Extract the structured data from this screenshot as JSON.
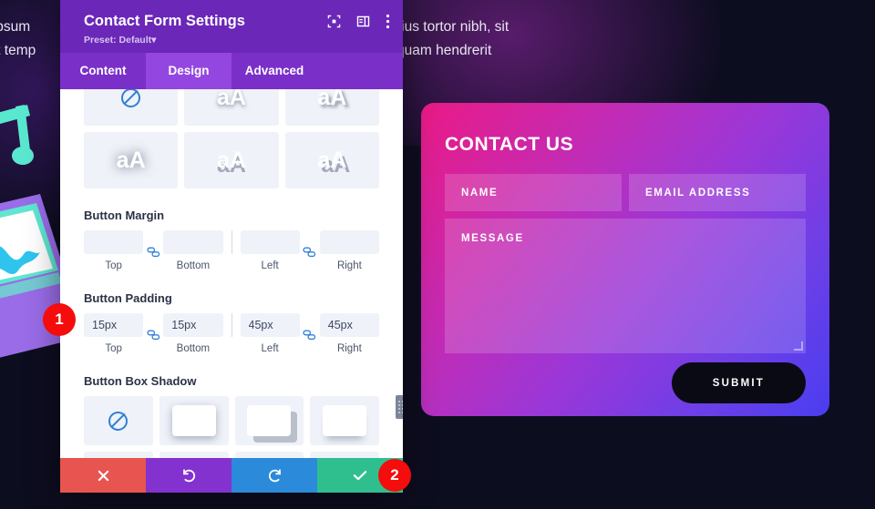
{
  "page": {
    "background_color": "#0d0d20",
    "copy_left": "em ipsum\namet temp",
    "copy_left_line1": "em ipsum",
    "copy_left_line2": "amet temp",
    "copy_right_line1": "rius tortor nibh, sit",
    "copy_right_line2": "quam hendrerit"
  },
  "contact_form": {
    "title": "CONTACT US",
    "gradient_start": "#ea1a86",
    "gradient_end": "#4a3def",
    "fields": [
      {
        "name": "name",
        "placeholder": "NAME"
      },
      {
        "name": "email",
        "placeholder": "EMAIL ADDRESS"
      }
    ],
    "message_placeholder": "MESSAGE",
    "submit_label": "SUBMIT",
    "submit_bg": "#0a0a14"
  },
  "modal": {
    "title": "Contact Form Settings",
    "preset_label": "Preset: Default",
    "preset_caret": "▾",
    "header_bg": "#6b27b8",
    "header_icons": [
      {
        "name": "focus-target-icon"
      },
      {
        "name": "layout-panel-icon"
      },
      {
        "name": "more-vertical-icon"
      }
    ],
    "tabs": [
      {
        "label": "Content",
        "active": false
      },
      {
        "label": "Design",
        "active": true
      },
      {
        "label": "Advanced",
        "active": false
      }
    ],
    "text_shadow": {
      "presets": [
        {
          "name": "none",
          "glyph": "",
          "style": "none"
        },
        {
          "name": "shadow-soft",
          "glyph": "aA",
          "style": "sh-1"
        },
        {
          "name": "shadow-offset-right",
          "glyph": "aA",
          "style": "sh-2"
        },
        {
          "name": "shadow-glow",
          "glyph": "aA",
          "style": "sh-3"
        },
        {
          "name": "shadow-hard-bottom",
          "glyph": "aA",
          "style": "sh-4"
        },
        {
          "name": "shadow-hard-diagonal",
          "glyph": "aA",
          "style": "sh-5"
        }
      ]
    },
    "button_margin": {
      "label": "Button Margin",
      "link_icon": "link-chain-icon",
      "inputs": [
        {
          "side": "Top",
          "value": "",
          "placeholder": ""
        },
        {
          "side": "Bottom",
          "value": "",
          "placeholder": ""
        },
        {
          "side": "Left",
          "value": "",
          "placeholder": ""
        },
        {
          "side": "Right",
          "value": "",
          "placeholder": ""
        }
      ]
    },
    "button_padding": {
      "label": "Button Padding",
      "link_icon": "link-chain-icon",
      "inputs": [
        {
          "side": "Top",
          "value": "15px",
          "placeholder": ""
        },
        {
          "side": "Bottom",
          "value": "15px",
          "placeholder": ""
        },
        {
          "side": "Left",
          "value": "45px",
          "placeholder": ""
        },
        {
          "side": "Right",
          "value": "45px",
          "placeholder": ""
        }
      ]
    },
    "button_box_shadow": {
      "label": "Button Box Shadow",
      "presets": [
        {
          "name": "none",
          "style": "none"
        },
        {
          "name": "shadow-all-soft",
          "style": "bs-1"
        },
        {
          "name": "shadow-diagonal",
          "style": "bs-2"
        },
        {
          "name": "shadow-bottom",
          "style": "bs-3"
        }
      ]
    },
    "footer": [
      {
        "name": "discard-changes-button",
        "icon": "x-icon",
        "color": "#e8544f"
      },
      {
        "name": "undo-button",
        "icon": "undo-icon",
        "color": "#8432cf"
      },
      {
        "name": "redo-button",
        "icon": "redo-icon",
        "color": "#2b8ad9"
      },
      {
        "name": "save-changes-button",
        "icon": "check-icon",
        "color": "#2fbf8f"
      }
    ]
  },
  "annotations": [
    {
      "number": "1",
      "color": "#f50c0c"
    },
    {
      "number": "2",
      "color": "#f50c0c"
    }
  ]
}
